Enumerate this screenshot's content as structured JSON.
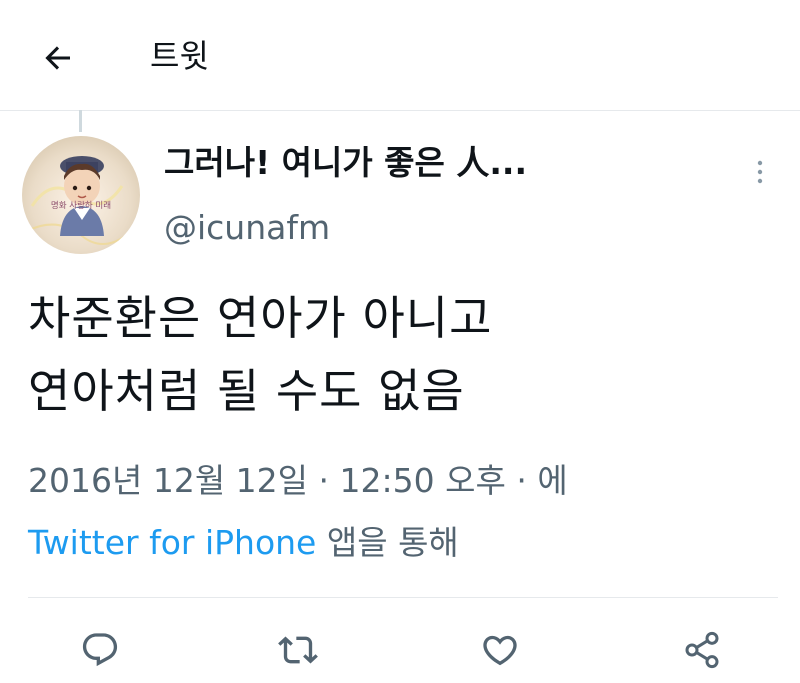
{
  "header": {
    "back_icon": "arrow-left-icon",
    "title": "트윗"
  },
  "tweet": {
    "display_name": "그러나! 여니가 좋은 人...",
    "username": "@icunafm",
    "avatar_stamp": "명화 사랑하 미래",
    "text_lines": [
      "차준환은 연아가 아니고",
      "연아처럼 될 수도 없음"
    ],
    "date": "2016년 12월 12일",
    "separator": "·",
    "time": "12:50 오후",
    "meta_suffix": "에",
    "source": "Twitter for iPhone",
    "source_suffix": "앱을 통해"
  },
  "actions": {
    "reply_icon": "reply-icon",
    "retweet_icon": "retweet-icon",
    "like_icon": "heart-icon",
    "share_icon": "share-icon"
  },
  "colors": {
    "text": "#0f1419",
    "secondary": "#536471",
    "link": "#1d9bf0",
    "divider": "#e6e9ec"
  }
}
